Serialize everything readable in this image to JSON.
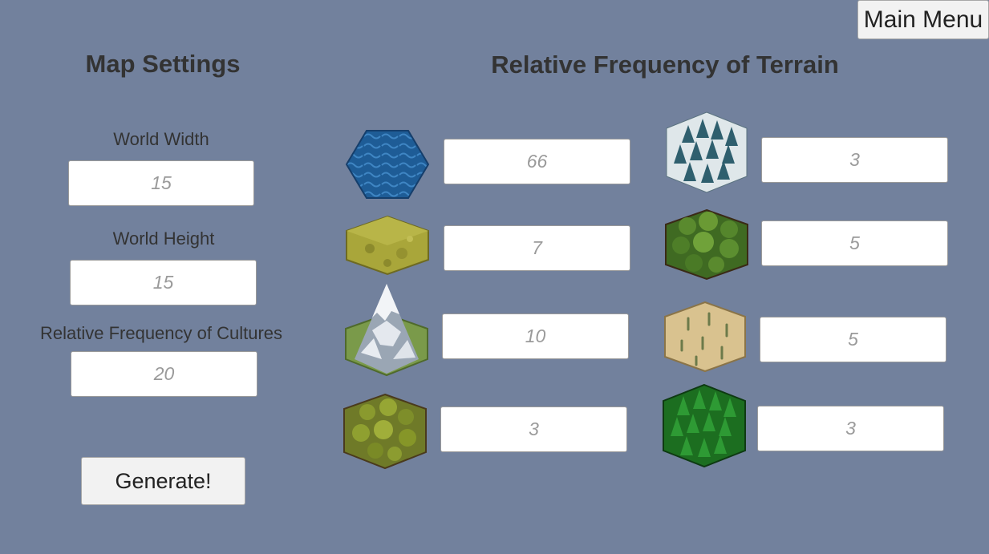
{
  "header": {
    "main_menu_label": "Main Menu"
  },
  "map_settings": {
    "title": "Map Settings",
    "world_width": {
      "label": "World Width",
      "placeholder": "15"
    },
    "world_height": {
      "label": "World Height",
      "placeholder": "15"
    },
    "culture_frequency": {
      "label": "Relative Frequency of Cultures",
      "placeholder": "20"
    },
    "generate_label": "Generate!"
  },
  "terrain": {
    "title": "Relative Frequency of Terrain",
    "items": [
      {
        "icon": "water-hex-icon",
        "placeholder": "66"
      },
      {
        "icon": "grassland-hex-icon",
        "placeholder": "7"
      },
      {
        "icon": "mountain-hex-icon",
        "placeholder": "10"
      },
      {
        "icon": "shrubland-hex-icon",
        "placeholder": "3"
      },
      {
        "icon": "snowy-forest-hex-icon",
        "placeholder": "3"
      },
      {
        "icon": "forest-hex-icon",
        "placeholder": "5"
      },
      {
        "icon": "desert-hex-icon",
        "placeholder": "5"
      },
      {
        "icon": "pine-forest-hex-icon",
        "placeholder": "3"
      }
    ]
  },
  "colors": {
    "background": "#72819d",
    "water": "#1f5f9a",
    "grass": "#a8a83a",
    "desert": "#d8c190",
    "pine": "#1d7a22"
  }
}
